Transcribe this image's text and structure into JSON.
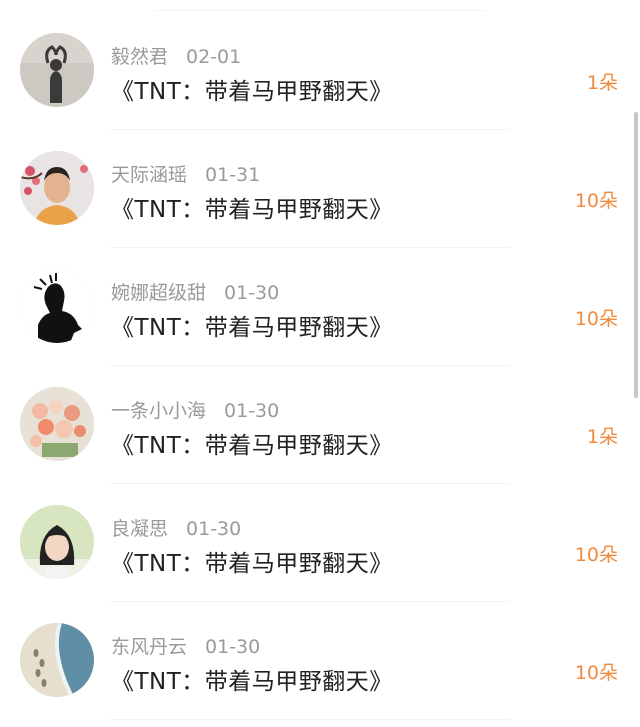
{
  "gifts": [
    {
      "username": "毅然君",
      "date": "02-01",
      "title": "《TNT：带着马甲野翻天》",
      "count": "1朵",
      "avatar_icon": "silhouette-heart-hands-avatar"
    },
    {
      "username": "天际涵瑶",
      "date": "01-31",
      "title": "《TNT：带着马甲野翻天》",
      "count": "10朵",
      "avatar_icon": "woman-plum-blossom-avatar"
    },
    {
      "username": "婉娜超级甜",
      "date": "01-30",
      "title": "《TNT：带着马甲野翻天》",
      "count": "10朵",
      "avatar_icon": "black-silhouette-avatar"
    },
    {
      "username": "一条小小海",
      "date": "01-30",
      "title": "《TNT：带着马甲野翻天》",
      "count": "1朵",
      "avatar_icon": "roses-bouquet-avatar"
    },
    {
      "username": "良凝思",
      "date": "01-30",
      "title": "《TNT：带着马甲野翻天》",
      "count": "10朵",
      "avatar_icon": "girl-photo-avatar"
    },
    {
      "username": "东风丹云",
      "date": "01-30",
      "title": "《TNT：带着马甲野翻天》",
      "count": "10朵",
      "avatar_icon": "beach-footprints-avatar"
    }
  ],
  "colors": {
    "count": "#f08a3c",
    "meta": "#9a9a9a",
    "title": "#222222"
  }
}
